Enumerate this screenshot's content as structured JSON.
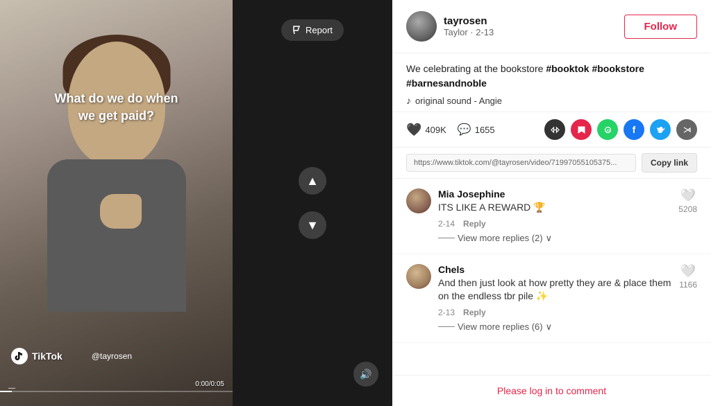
{
  "video": {
    "overlay_text": "What do we do when we get paid?",
    "handle": "@tayrosen",
    "tiktok_brand": "TikTok",
    "time_current": "0:00",
    "time_total": "0:05",
    "report_label": "Report"
  },
  "header": {
    "username": "tayrosen",
    "subtitle": "Taylor · 2-13",
    "follow_label": "Follow"
  },
  "caption": {
    "text_plain": "We celebrating at the bookstore ",
    "hashtag1": "#booktok",
    "hashtag2": "#bookstore",
    "hashtag3": "#barnesandnoble",
    "sound": "original sound - Angie"
  },
  "actions": {
    "likes": "409K",
    "comments": "1655"
  },
  "link": {
    "url": "https://www.tiktok.com/@tayrosen/video/71997055105375...",
    "copy_label": "Copy link"
  },
  "comments": [
    {
      "username": "Mia Josephine",
      "text": "ITS LIKE A REWARD 🏆",
      "date": "2-14",
      "reply_label": "Reply",
      "likes": "5208",
      "view_replies": "View more replies (2)"
    },
    {
      "username": "Chels",
      "text": "And then just look at how pretty they are & place them on the endless tbr pile ✨",
      "date": "2-13",
      "reply_label": "Reply",
      "likes": "1166",
      "view_replies": "View more replies (6)"
    }
  ],
  "footer": {
    "login_text": "Please log in to comment"
  },
  "nav": {
    "up_label": "▲",
    "down_label": "▼",
    "volume_label": "🔊"
  }
}
